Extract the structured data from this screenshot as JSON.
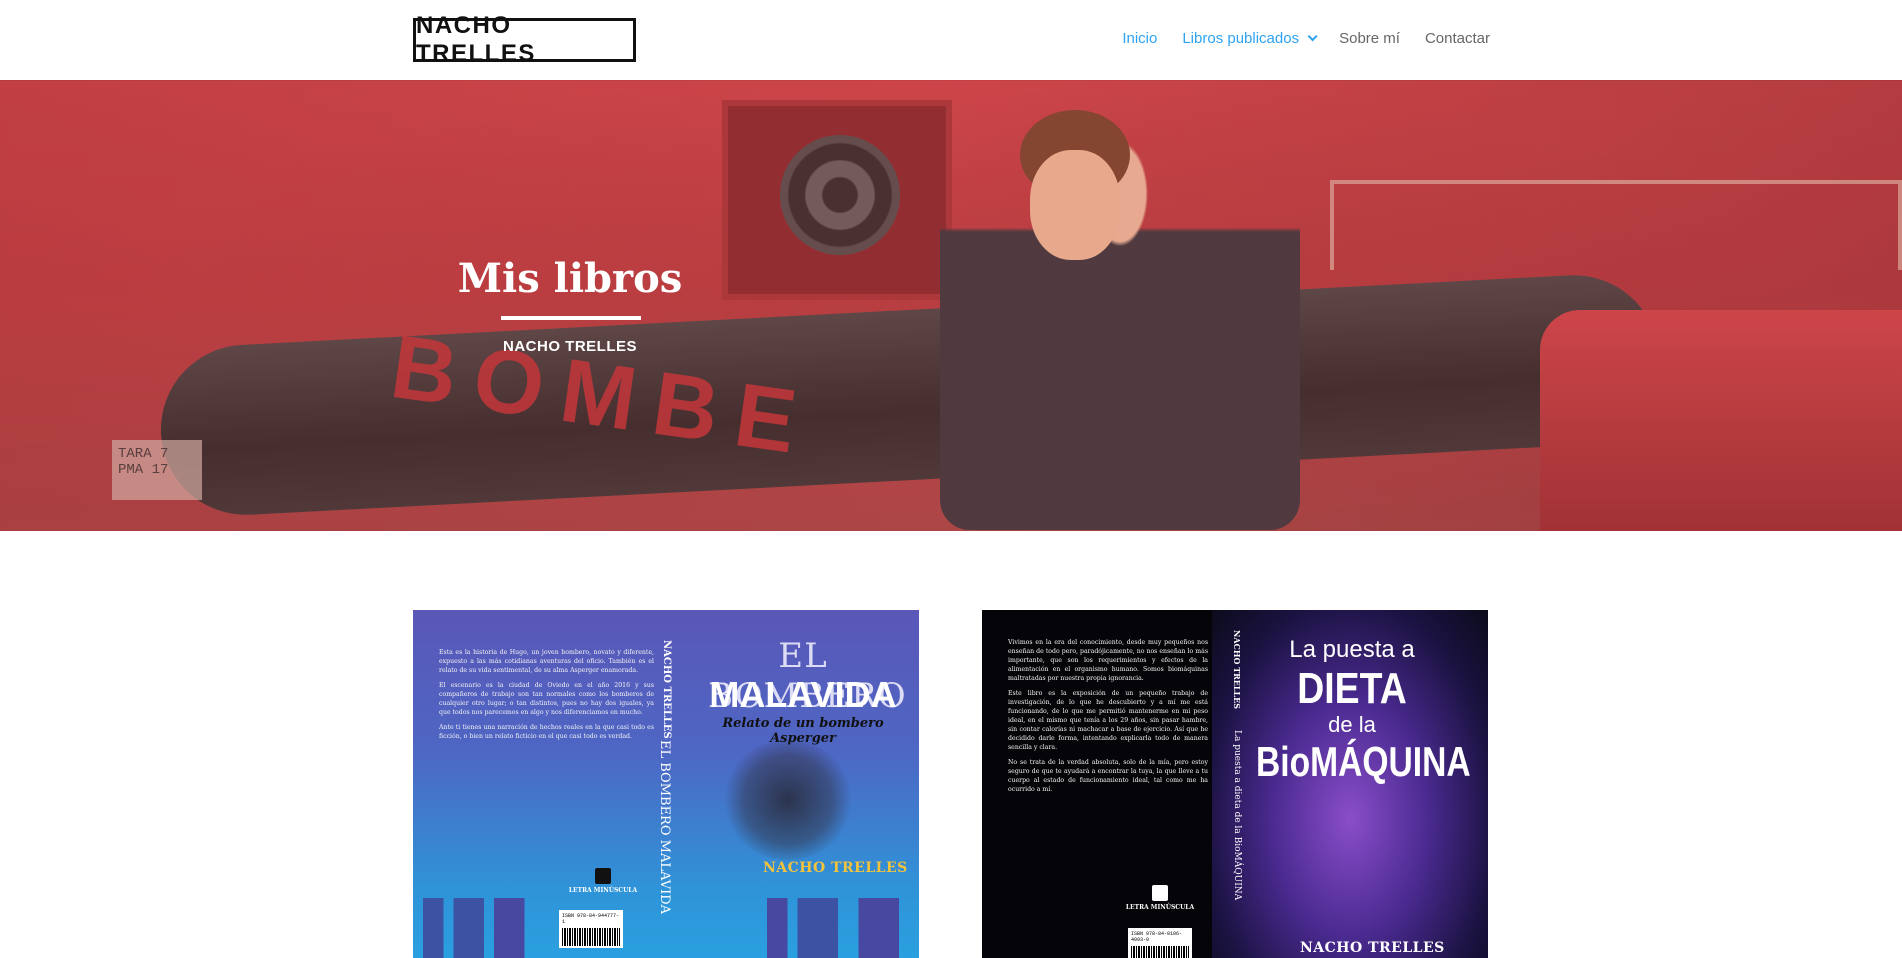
{
  "header": {
    "logo_text": "NACHO TRELLES",
    "nav": [
      {
        "label": "Inicio",
        "active": true
      },
      {
        "label": "Libros publicados",
        "active": true,
        "has_dropdown": true
      },
      {
        "label": "Sobre mí",
        "active": false
      },
      {
        "label": "Contactar",
        "active": false
      }
    ]
  },
  "hero": {
    "title": "Mis libros",
    "subtitle": "NACHO TRELLES",
    "plate_text": "TARA 7\nPMA 17",
    "raft_text": "BOMBE"
  },
  "books": [
    {
      "back_paragraphs": [
        "Esta es la historia de Hugo, un joven bombero, novato y diferente, expuesto a las más cotidianas aventuras del oficio. También es el relato de su vida sentimental, de su alma Asperger enamorada.",
        "El escenario es la ciudad de Oviedo en el año 2016 y sus compañeros de trabajo son tan normales como los bomberos de cualquier otro lugar; o tan distintos, pues no hay dos iguales, ya que todos nos parecemos en algo y nos diferenciamos en mucho.",
        "Ante ti tienes una narración de hechos reales en la que casi todo es ficción, o bien un relato ficticio en el que casi todo es verdad."
      ],
      "spine_author": "NACHO TRELLES",
      "spine_title": "EL BOMBERO MALAVIDA",
      "title_line1": "EL BOMBERO",
      "title_line2": "MALAVIDA",
      "subtitle": "Relato de un bombero Asperger",
      "author": "NACHO TRELLES",
      "publisher": "LETRA MINÚSCULA",
      "isbn": "ISBN 978-84-944777-1"
    },
    {
      "back_paragraphs": [
        "Vivimos en la era del conocimiento, desde muy pequeños nos enseñan de todo pero, paradójicamente, no nos enseñan lo más importante, que son los requerimientos y efectos de la alimentación en el organismo humano. Somos biomáquinas maltratadas por nuestra propia ignorancia.",
        "Este libro es la exposición de un pequeño trabajo de investigación, de lo que he descubierto y a mí me está funcionando, de lo que me permitió mantenerme en mi peso ideal, en el mismo que tenía a los 29 años, sin pasar hambre, sin contar calorías ni machacar a base de ejercicio. Así que he decidido darle forma, intentando explicarla todo de manera sencilla y clara.",
        "No se trata de la verdad absoluta, solo de la mía, pero estoy seguro de que te ayudará a encontrar la tuya, la que lleve a tu cuerpo al estado de funcionamiento ideal, tal como me ha ocurrido a mí."
      ],
      "spine_author": "NACHO TRELLES",
      "spine_title": "La puesta a dieta de la BioMÁQUINA",
      "title_line1": "La puesta a",
      "title_line2": "DIETA",
      "title_line3": "de la",
      "title_line4": "BioMÁQUINA",
      "author": "NACHO TRELLES",
      "publisher": "LETRA MINÚSCULA",
      "isbn": "ISBN 978-84-0106-4093-0"
    }
  ]
}
